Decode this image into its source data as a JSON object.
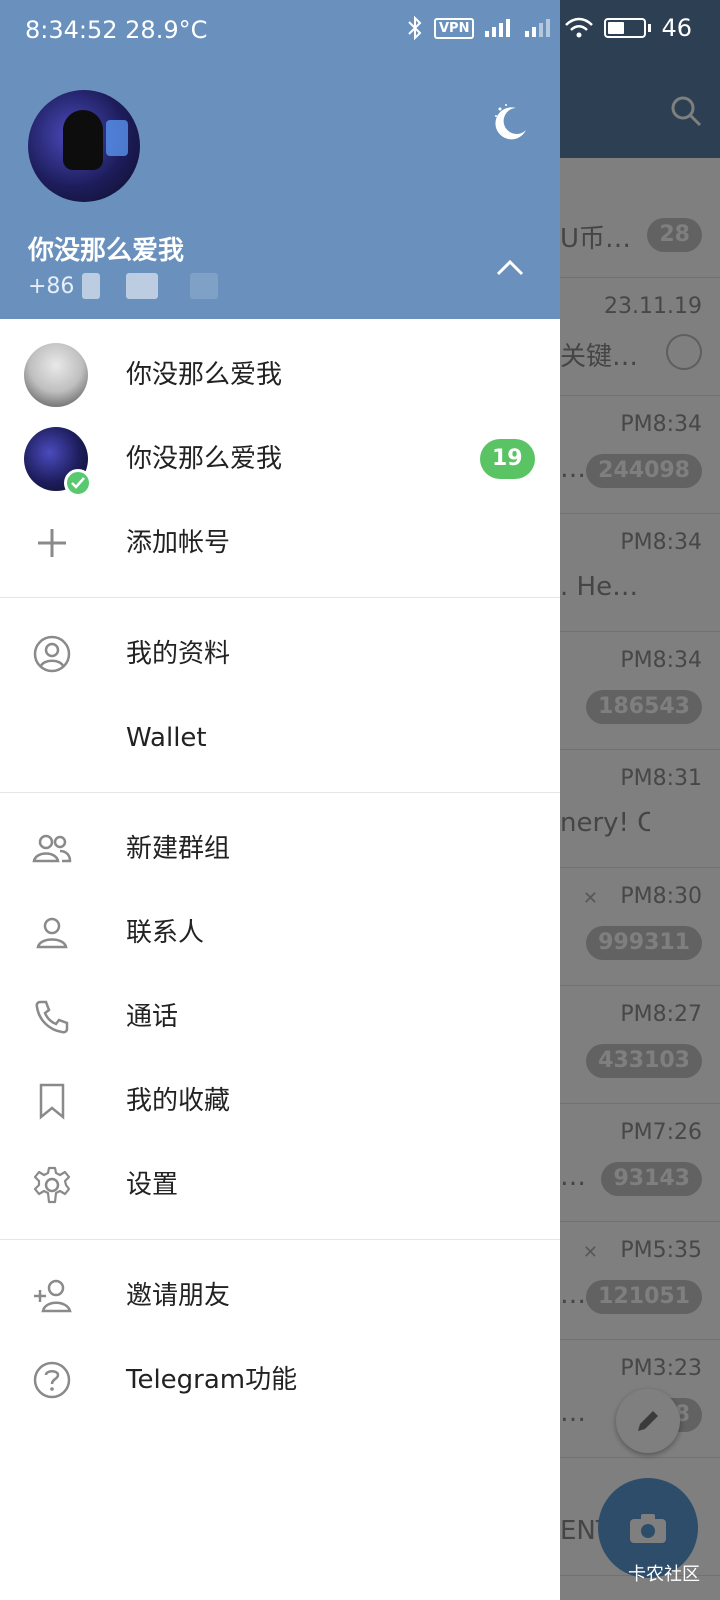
{
  "status_bar": {
    "time_temp": "8:34:52 28.9°C",
    "vpn": "VPN",
    "battery": "46"
  },
  "drawer_header": {
    "name": "你没那么爱我",
    "phone_prefix": "+86"
  },
  "accounts": [
    {
      "name": "你没那么爱我",
      "badge": ""
    },
    {
      "name": "你没那么爱我",
      "badge": "19",
      "active": true
    }
  ],
  "add_account_label": "添加帐号",
  "menu_group_1": [
    {
      "label": "我的资料",
      "icon": "profile-icon"
    },
    {
      "label": "Wallet",
      "icon": ""
    }
  ],
  "menu_group_2": [
    {
      "label": "新建群组",
      "icon": "group-icon"
    },
    {
      "label": "联系人",
      "icon": "contacts-icon"
    },
    {
      "label": "通话",
      "icon": "phone-icon"
    },
    {
      "label": "我的收藏",
      "icon": "bookmark-icon"
    },
    {
      "label": "设置",
      "icon": "gear-icon"
    }
  ],
  "menu_group_3": [
    {
      "label": "邀请朋友",
      "icon": "invite-icon"
    },
    {
      "label": "Telegram功能",
      "icon": "help-icon"
    }
  ],
  "background_chats": [
    {
      "time": "",
      "preview": "U币…",
      "badge": "28"
    },
    {
      "time": "23.11.19",
      "preview": "关键…",
      "badge": ""
    },
    {
      "time": "PM8:34",
      "preview": "…",
      "badge": "244098"
    },
    {
      "time": "PM8:34",
      "preview": ". He…",
      "badge": ""
    },
    {
      "time": "PM8:34",
      "preview": "",
      "badge": "186543"
    },
    {
      "time": "PM8:31",
      "preview": "nery!  C…",
      "badge": ""
    },
    {
      "time": "PM8:30",
      "preview": "",
      "badge": "999311"
    },
    {
      "time": "PM8:27",
      "preview": "",
      "badge": "433103"
    },
    {
      "time": "PM7:26",
      "preview": "…",
      "badge": "93143"
    },
    {
      "time": "PM5:35",
      "preview": "…",
      "badge": "121051"
    },
    {
      "time": "PM3:23",
      "preview": "…",
      "badge": "28"
    },
    {
      "time": "",
      "preview": "ENT…",
      "badge": ""
    }
  ],
  "watermark": "卡农社区",
  "colors": {
    "header_blue": "#6a91bd",
    "badge_green": "#5ac363",
    "icon_gray": "#8a8a8a"
  }
}
